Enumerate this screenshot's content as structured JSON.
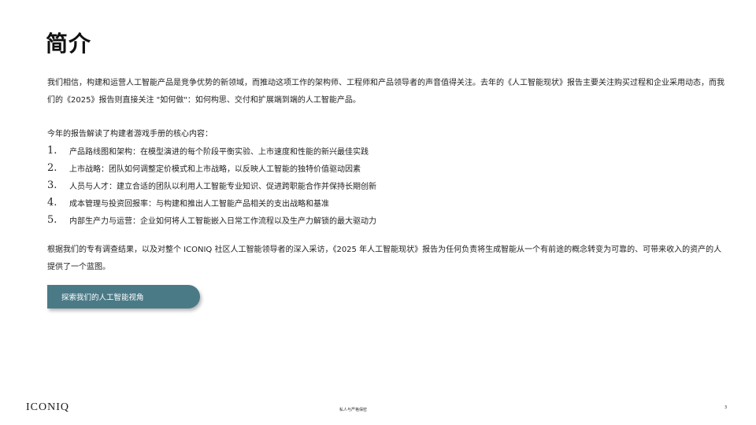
{
  "slide": {
    "title": "简介",
    "intro": "我们相信，构建和运营人工智能产品是竞争优势的新领域，而推动这项工作的架构师、工程师和产品领导者的声音值得关注。去年的《人工智能现状》报告主要关注购买过程和企业采用动态，而我们的《2025》报告则直接关注 \"如何做\"：如何构思、交付和扩展端到端的人工智能产品。",
    "list_lead": "今年的报告解读了构建者游戏手册的核心内容：",
    "items": [
      {
        "number": "1.",
        "text": "产品路线图和架构：在模型演进的每个阶段平衡实验、上市速度和性能的新兴最佳实践"
      },
      {
        "number": "2.",
        "text": "上市战略：团队如何调整定价模式和上市战略，以反映人工智能的独特价值驱动因素"
      },
      {
        "number": "3.",
        "text": "人员与人才：建立合适的团队以利用人工智能专业知识、促进跨职能合作并保持长期创新"
      },
      {
        "number": "4.",
        "text": "成本管理与投资回报率：与构建和推出人工智能产品相关的支出战略和基准"
      },
      {
        "number": "5.",
        "text": "内部生产力与运营：企业如何将人工智能嵌入日常工作流程以及生产力解锁的最大驱动力"
      }
    ],
    "closing": "根据我们的专有调查结果，以及对整个 ICONIQ 社区人工智能领导者的深入采访，《2025 年人工智能现状》报告为任何负责将生成智能从一个有前途的概念转变为可靠的、可带来收入的资产的人提供了一个蓝图。",
    "cta_label": "探索我们的人工智能视角"
  },
  "footer": {
    "logo": "ICONIQ",
    "center_text": "私人与严格保密",
    "page_number": "3"
  },
  "colors": {
    "cta_background": "#4b7a87",
    "text": "#222222"
  }
}
